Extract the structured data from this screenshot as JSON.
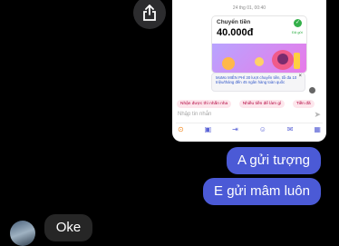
{
  "screenshot": {
    "date": "24 thg 01, 00:40",
    "card": {
      "title": "Chuyển tiền",
      "amount": "40.000đ",
      "status": "Đã gửi"
    },
    "promo": "MoMo MIỄN PHÍ 30 lượt chuyển tiền, tối đa 10 triệu/tháng đến 45 ngân hàng toàn quốc",
    "chips": [
      "Nhận được thì nhắn nha",
      "Nhiều tiền để làm gì",
      "Tiền đã"
    ],
    "composer_placeholder": "Nhập tin nhắn",
    "toolbar_icons": [
      "coin-icon",
      "image-icon",
      "transfer-icon",
      "sticker-icon",
      "gift-icon",
      "game-icon"
    ]
  },
  "messages": [
    {
      "from": "me",
      "text": "A gửi tượng"
    },
    {
      "from": "me",
      "text": "E gửi mâm luôn"
    },
    {
      "from": "friend",
      "text": "Oke"
    }
  ],
  "colors": {
    "outgoing": "#4b5ad6",
    "incoming": "#262626",
    "background": "#000000"
  }
}
